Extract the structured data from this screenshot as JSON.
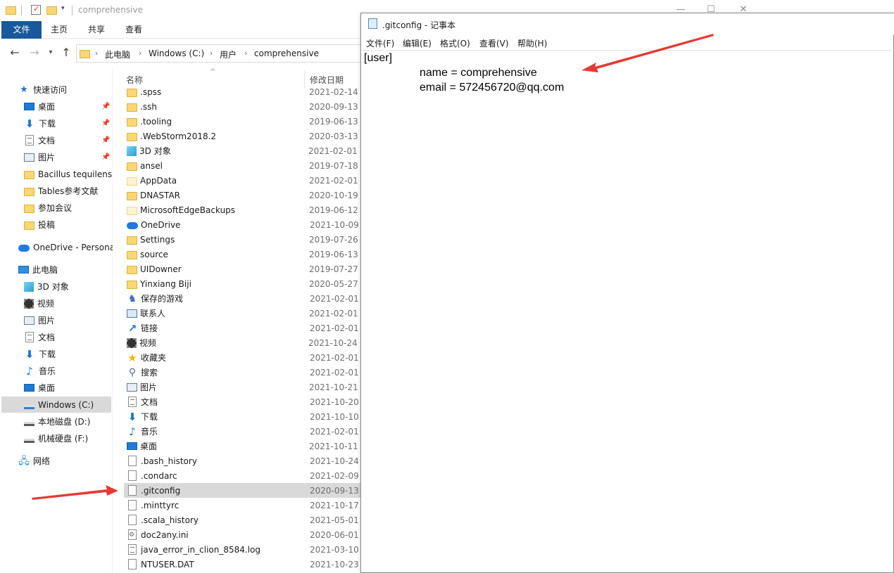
{
  "explorer": {
    "title": "comprehensive",
    "ribbon_tabs": [
      "文件",
      "主页",
      "共享",
      "查看"
    ],
    "breadcrumbs": [
      "此电脑",
      "Windows (C:)",
      "用户",
      "comprehensive"
    ],
    "column_name": "名称",
    "column_date": "修改日期",
    "sidebar": {
      "quick_access": "快速访问",
      "quick_items": [
        "桌面",
        "下载",
        "文档",
        "图片",
        "Bacillus tequilensi",
        "Tables参考文献",
        "参加会议",
        "投稿"
      ],
      "onedrive": "OneDrive - Persona",
      "this_pc": "此电脑",
      "pc_items": [
        "3D 对象",
        "视频",
        "图片",
        "文档",
        "下载",
        "音乐",
        "桌面",
        "Windows (C:)",
        "本地磁盘 (D:)",
        "机械硬盘 (F:)"
      ],
      "network": "网络"
    },
    "files": [
      {
        "name": ".spss",
        "date": "2021-02-14",
        "icon": "folder-icon"
      },
      {
        "name": ".ssh",
        "date": "2020-09-13",
        "icon": "folder-icon"
      },
      {
        "name": ".tooling",
        "date": "2019-06-13",
        "icon": "folder-icon"
      },
      {
        "name": ".WebStorm2018.2",
        "date": "2020-03-13",
        "icon": "folder-icon"
      },
      {
        "name": "3D 对象",
        "date": "2021-02-01",
        "icon": "3d-objects-icon"
      },
      {
        "name": "ansel",
        "date": "2019-07-18",
        "icon": "folder-icon"
      },
      {
        "name": "AppData",
        "date": "2021-02-01",
        "icon": "folder-icon"
      },
      {
        "name": "DNASTAR",
        "date": "2020-10-19",
        "icon": "folder-icon"
      },
      {
        "name": "MicrosoftEdgeBackups",
        "date": "2019-06-12",
        "icon": "folder-icon"
      },
      {
        "name": "OneDrive",
        "date": "2021-10-09",
        "icon": "onedrive-icon"
      },
      {
        "name": "Settings",
        "date": "2019-07-26",
        "icon": "folder-icon"
      },
      {
        "name": "source",
        "date": "2019-06-13",
        "icon": "folder-icon"
      },
      {
        "name": "UIDowner",
        "date": "2019-07-27",
        "icon": "folder-icon"
      },
      {
        "name": "Yinxiang Biji",
        "date": "2020-05-27",
        "icon": "folder-icon"
      },
      {
        "name": "保存的游戏",
        "date": "2021-02-01",
        "icon": "saved-games-icon"
      },
      {
        "name": "联系人",
        "date": "2021-02-01",
        "icon": "contacts-icon"
      },
      {
        "name": "链接",
        "date": "2021-02-01",
        "icon": "links-icon"
      },
      {
        "name": "视频",
        "date": "2021-10-24",
        "icon": "videos-icon"
      },
      {
        "name": "收藏夹",
        "date": "2021-02-01",
        "icon": "favorites-icon"
      },
      {
        "name": "搜索",
        "date": "2021-02-01",
        "icon": "searches-icon"
      },
      {
        "name": "图片",
        "date": "2021-10-21",
        "icon": "pictures-icon"
      },
      {
        "name": "文档",
        "date": "2021-10-20",
        "icon": "documents-icon"
      },
      {
        "name": "下载",
        "date": "2021-10-10",
        "icon": "downloads-icon"
      },
      {
        "name": "音乐",
        "date": "2021-02-01",
        "icon": "music-icon"
      },
      {
        "name": "桌面",
        "date": "2021-10-11",
        "icon": "desktop-icon"
      },
      {
        "name": ".bash_history",
        "date": "2021-10-24",
        "icon": "file-icon"
      },
      {
        "name": ".condarc",
        "date": "2021-02-09",
        "icon": "file-icon"
      },
      {
        "name": ".gitconfig",
        "date": "2020-09-13",
        "icon": "file-icon"
      },
      {
        "name": ".minttyrc",
        "date": "2021-10-17",
        "icon": "file-icon"
      },
      {
        "name": ".scala_history",
        "date": "2021-05-01",
        "icon": "file-icon"
      },
      {
        "name": "doc2any.ini",
        "date": "2020-06-01",
        "icon": "settings-file-icon"
      },
      {
        "name": "java_error_in_clion_8584.log",
        "date": "2021-03-10",
        "icon": "text-file-icon"
      },
      {
        "name": "NTUSER.DAT",
        "date": "2021-10-23",
        "icon": "file-icon"
      }
    ]
  },
  "notepad": {
    "title": ".gitconfig - 记事本",
    "menus": [
      "文件(F)",
      "编辑(E)",
      "格式(O)",
      "查看(V)",
      "帮助(H)"
    ],
    "lines": [
      "[user]",
      "name = comprehensive",
      "email = 572456720@qq.com"
    ]
  },
  "colors": {
    "file_tab": "#19599b",
    "selection": "#d9d9d9",
    "arrow": "#e53935"
  }
}
